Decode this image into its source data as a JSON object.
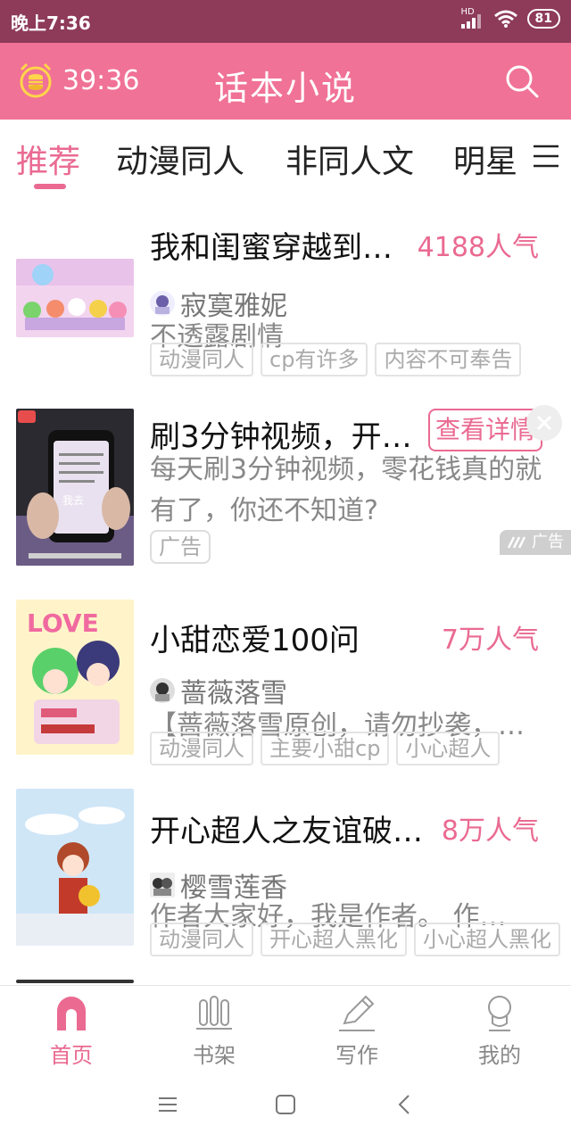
{
  "status_bar": {
    "time": "晚上7:36",
    "network": "HD",
    "battery": "81"
  },
  "header": {
    "timer": "39:36",
    "title": "话本小说"
  },
  "tabs": [
    {
      "label": "推荐",
      "active": true
    },
    {
      "label": "动漫同人",
      "active": false
    },
    {
      "label": "非同人文",
      "active": false
    },
    {
      "label": "明星同人",
      "active": false
    }
  ],
  "feed": {
    "cards": [
      {
        "title": "我和闺蜜穿越到…",
        "popularity": "4188人气",
        "author": "寂寞雅妮",
        "description": "不透露剧情",
        "tags": [
          "动漫同人",
          "cp有许多",
          "内容不可奉告"
        ]
      },
      {
        "title": "小甜恋爱100问",
        "popularity": "7万人气",
        "author": "蔷薇落雪",
        "description": "【蔷薇落雪原创，请勿抄袭，…",
        "tags": [
          "动漫同人",
          "主要小甜cp",
          "小心超人"
        ]
      },
      {
        "title": "开心超人之友谊破…",
        "popularity": "8万人气",
        "author": "樱雪莲香",
        "description": "作者大家好，我是作者。 作…",
        "tags": [
          "动漫同人",
          "开心超人黑化",
          "小心超人黑化"
        ]
      }
    ],
    "ad": {
      "title": "刷3分钟视频，开…",
      "button": "查看详情",
      "description": "每天刷3分钟视频，零花钱真的就有了，你还不知道?",
      "tag": "广告",
      "mark": "广告",
      "image_text": "我去"
    }
  },
  "bottom_nav": [
    {
      "label": "首页",
      "icon": "home-icon",
      "active": true
    },
    {
      "label": "书架",
      "icon": "bookshelf-icon",
      "active": false
    },
    {
      "label": "写作",
      "icon": "pen-icon",
      "active": false
    },
    {
      "label": "我的",
      "icon": "profile-icon",
      "active": false
    }
  ],
  "colors": {
    "accent": "#ea6a92",
    "header_bg": "#f07296",
    "status_bg": "#8e3a59"
  }
}
